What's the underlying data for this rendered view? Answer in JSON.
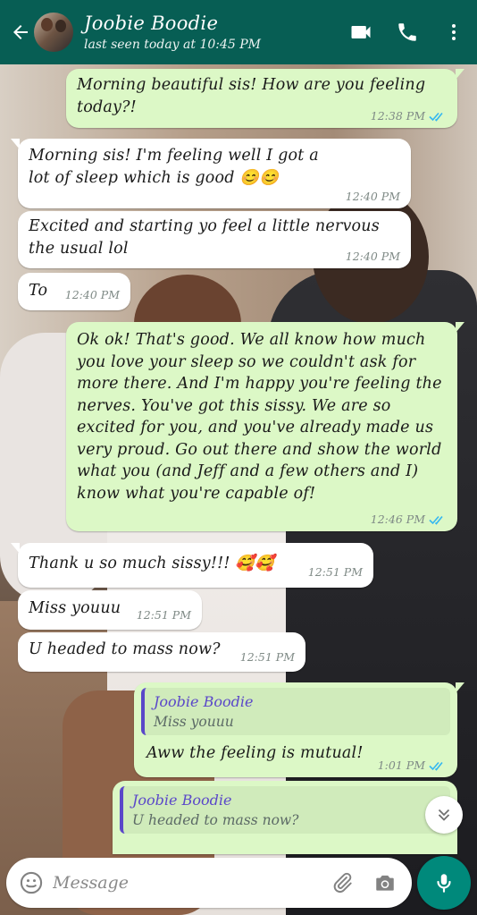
{
  "header": {
    "contact_name": "Joobie Boodie",
    "last_seen": "last seen today at 10:45 PM",
    "bg_color": "#075e54"
  },
  "messages": [
    {
      "dir": "out",
      "text": "Morning beautiful sis! How are you feeling today?!",
      "time": "12:38 PM",
      "read": true
    },
    {
      "dir": "in",
      "text": "Morning sis! I'm feeling well I got a lot of sleep which is good 😊😊",
      "time": "12:40 PM"
    },
    {
      "dir": "in",
      "text": "Excited and starting yo feel a little nervous the usual lol",
      "time": "12:40 PM"
    },
    {
      "dir": "in",
      "text": "To",
      "time": "12:40 PM"
    },
    {
      "dir": "out",
      "text": "Ok ok! That's good. We all know how much you love your sleep so we couldn't ask for more there. And I'm happy you're feeling the nerves. You've got this sissy. We are so excited for you, and you've already made us very proud. Go out there and show the world what you (and Jeff and a few others and I) know what you're capable of!",
      "time": "12:46 PM",
      "read": true
    },
    {
      "dir": "in",
      "text": "Thank u so much sissy!!! 🥰🥰",
      "time": "12:51 PM"
    },
    {
      "dir": "in",
      "text": "Miss youuu",
      "time": "12:51 PM"
    },
    {
      "dir": "in",
      "text": "U headed to mass now?",
      "time": "12:51 PM"
    },
    {
      "dir": "out",
      "quote_name": "Joobie Boodie",
      "quote_text": "Miss youuu",
      "text": "Aww the feeling is mutual!",
      "time": "1:01 PM",
      "read": true
    },
    {
      "dir": "out",
      "quote_name": "Joobie Boodie",
      "quote_text": "U headed to mass now?",
      "text": "",
      "time": ""
    }
  ],
  "input": {
    "placeholder": "Message"
  },
  "icons": {
    "back": "arrow-left-icon",
    "video": "video-camera-icon",
    "call": "phone-icon",
    "menu": "more-vert-icon",
    "emoji": "emoji-icon",
    "attach": "paperclip-icon",
    "camera": "camera-icon",
    "mic": "microphone-icon",
    "scroll": "double-chevron-down-icon"
  },
  "colors": {
    "outgoing": "#dcf8c6",
    "incoming": "#ffffff",
    "read_tick": "#34b7f1",
    "quote_accent": "#5a47c9",
    "fab": "#00897b"
  }
}
